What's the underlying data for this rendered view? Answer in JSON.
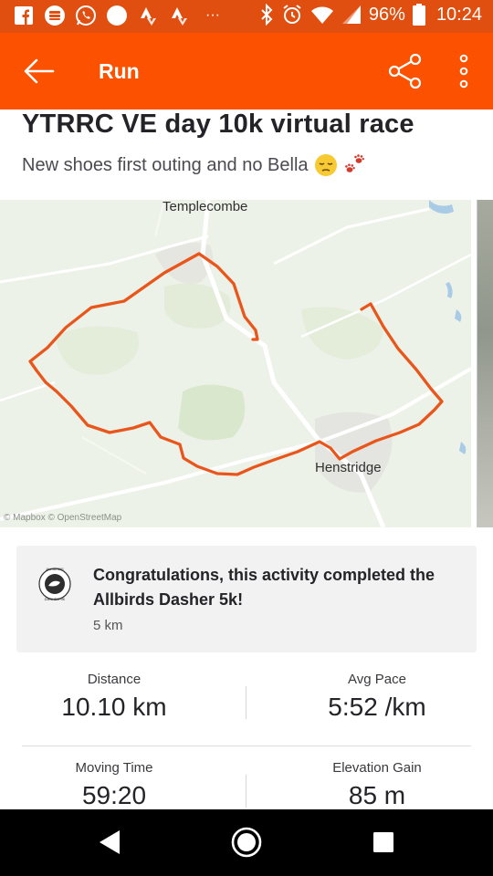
{
  "status_bar": {
    "battery_percent": "96%",
    "time": "10:24",
    "overflow": "···",
    "left_icons": [
      "facebook-icon",
      "stack-icon",
      "whatsapp-icon",
      "circle-icon",
      "strava-icon",
      "strava-icon",
      "overflow-icon"
    ],
    "right_icons": [
      "bluetooth-icon",
      "alarm-icon",
      "wifi-icon",
      "signal-icon",
      "battery-icon"
    ]
  },
  "app_bar": {
    "title": "Run",
    "back_icon": "arrow-left-icon",
    "share_icon": "share-icon",
    "more_icon": "more-vertical-icon",
    "color": "#fc5200"
  },
  "activity": {
    "title": "YTRRC VE day 10k virtual race",
    "description": "New shoes first outing and no Bella",
    "emojis": [
      "pensive-face-emoji",
      "paw-prints-emoji"
    ]
  },
  "map": {
    "labels": [
      "Templecombe",
      "Henstridge"
    ],
    "attribution": "© Mapbox © OpenStreetMap",
    "route_color": "#e8561b"
  },
  "achievement": {
    "badge_icon": "allbirds-dasher-badge-icon",
    "badge_text_top": "ALLBIRDS",
    "badge_text_bottom": "DASHER 5K",
    "text": "Congratulations, this activity completed the Allbirds Dasher 5k!",
    "subtext": "5 km"
  },
  "stats": [
    {
      "label": "Distance",
      "value": "10.10 km"
    },
    {
      "label": "Avg Pace",
      "value": "5:52 /km"
    },
    {
      "label": "Moving Time",
      "value": "59:20"
    },
    {
      "label": "Elevation Gain",
      "value": "85 m"
    }
  ],
  "nav_bar": {
    "icons": [
      "nav-back-icon",
      "nav-home-icon",
      "nav-recents-icon"
    ]
  }
}
